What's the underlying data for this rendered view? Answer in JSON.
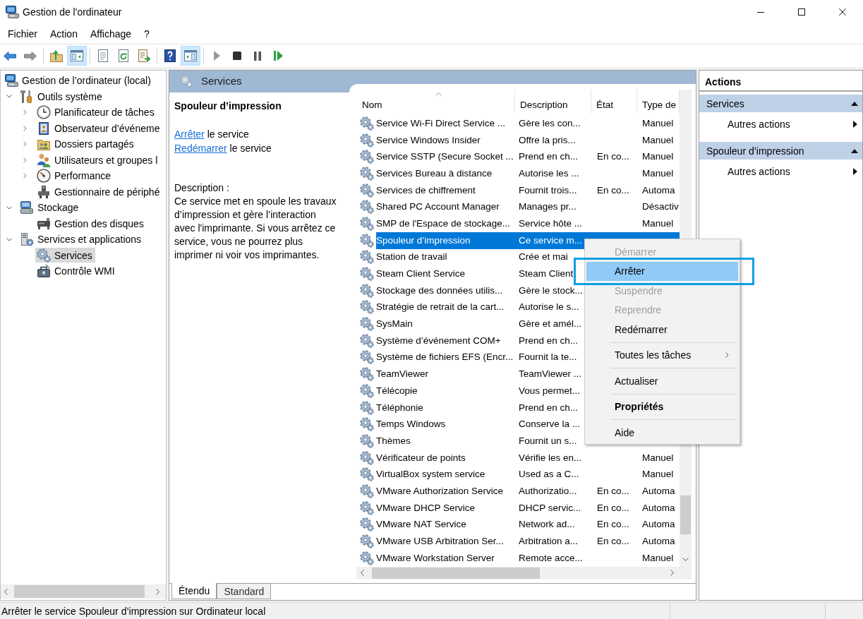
{
  "window": {
    "title": "Gestion de l'ordinateur"
  },
  "menu": [
    "Fichier",
    "Action",
    "Affichage",
    "?"
  ],
  "toolbar": [
    [
      {
        "disabled": false,
        "on": false
      },
      {
        "disabled": true,
        "on": false
      }
    ],
    [
      {
        "disabled": false,
        "on": false
      },
      {
        "disabled": false,
        "on": true
      }
    ],
    [
      {
        "disabled": false,
        "on": false
      },
      {
        "disabled": false,
        "on": false
      },
      {
        "disabled": false,
        "on": false
      }
    ],
    [
      {
        "disabled": false,
        "on": false
      },
      {
        "disabled": false,
        "on": true
      }
    ],
    [
      {
        "disabled": true,
        "on": false
      },
      {
        "disabled": false,
        "on": false
      },
      {
        "disabled": false,
        "on": false
      },
      {
        "disabled": false,
        "on": false
      }
    ]
  ],
  "tree": [
    {
      "label": "Gestion de l’ordinateur (local)",
      "selected": false,
      "children": [
        {
          "label": "Outils système",
          "expanded": true,
          "selected": false,
          "children": [
            {
              "label": "Planificateur de tâches",
              "expanded": false,
              "selected": false
            },
            {
              "label": "Observateur d’événeme",
              "expanded": false,
              "selected": false
            },
            {
              "label": "Dossiers partagés",
              "expanded": false,
              "selected": false
            },
            {
              "label": "Utilisateurs et groupes l",
              "expanded": false,
              "selected": false
            },
            {
              "label": "Performance",
              "expanded": false,
              "selected": false
            },
            {
              "label": "Gestionnaire de périphé",
              "selected": false
            }
          ]
        },
        {
          "label": "Stockage",
          "expanded": true,
          "selected": false,
          "children": [
            {
              "label": "Gestion des disques",
              "selected": false
            }
          ]
        },
        {
          "label": "Services et applications",
          "expanded": true,
          "selected": false,
          "children": [
            {
              "label": "Services",
              "selected": true
            },
            {
              "label": "Contrôle WMI",
              "selected": false
            }
          ]
        }
      ]
    }
  ],
  "console": {
    "title": "Services",
    "detail": {
      "heading": "Spouleur d’impression",
      "links": [
        {
          "link": "Arrêter",
          "text": "le service"
        },
        {
          "link": "Redémarrer",
          "text": "le service"
        }
      ],
      "description_label": "Description :",
      "description": "Ce service met en spoule les travaux d’impression et gère l’interaction avec l'imprimante. Si vous arrêtez ce service, vous ne pourrez plus imprimer ni voir vos imprimantes."
    },
    "table": {
      "columns": [
        {
          "label": "Nom",
          "sorted": true
        },
        {
          "label": "Description",
          "sorted": false
        },
        {
          "label": "État",
          "sorted": false
        },
        {
          "label": "Type de",
          "sorted": false
        }
      ],
      "rows": [
        {
          "name": "Service Wi-Fi Direct Service ...",
          "description": "Gère les con...",
          "startup_type": "Manuel",
          "selected": false
        },
        {
          "name": "Service Windows Insider",
          "description": "Offre la pris...",
          "startup_type": "Manuel",
          "selected": false
        },
        {
          "name": "Service SSTP (Secure Socket ...",
          "description": "Prend en ch...",
          "status": "En co...",
          "startup_type": "Manuel",
          "selected": false
        },
        {
          "name": "Services Bureau à distance",
          "description": "Autorise les ...",
          "startup_type": "Manuel",
          "selected": false
        },
        {
          "name": "Services de chiffrement",
          "description": "Fournit trois...",
          "status": "En co...",
          "startup_type": "Automa",
          "selected": false
        },
        {
          "name": "Shared PC Account Manager",
          "description": "Manages pr...",
          "startup_type": "Désactiv",
          "selected": false
        },
        {
          "name": "SMP de l'Espace de stockage...",
          "description": "Service hôte ...",
          "startup_type": "Manuel",
          "selected": false
        },
        {
          "name": "Spouleur d’impression",
          "description": "Ce service m...",
          "selected": true
        },
        {
          "name": "Station de travail",
          "description": "Crée et mai",
          "selected": false
        },
        {
          "name": "Steam Client Service",
          "description": "Steam Client",
          "selected": false
        },
        {
          "name": "Stockage des données utilis...",
          "description": "Gère le stock...",
          "selected": false
        },
        {
          "name": "Stratégie de retrait de la cart...",
          "description": "Autorise le s...",
          "selected": false
        },
        {
          "name": "SysMain",
          "description": "Gère et amél...",
          "selected": false
        },
        {
          "name": "Système d’événement COM+",
          "description": "Prend en ch...",
          "selected": false
        },
        {
          "name": "Système de fichiers EFS (Encr...",
          "description": "Fournit la te...",
          "selected": false
        },
        {
          "name": "TeamViewer",
          "description": "TeamViewer ...",
          "selected": false
        },
        {
          "name": "Télécopie",
          "description": "Vous permet...",
          "selected": false
        },
        {
          "name": "Téléphonie",
          "description": "Prend en ch...",
          "selected": false
        },
        {
          "name": "Temps Windows",
          "description": "Conserve la ...",
          "selected": false
        },
        {
          "name": "Thèmes",
          "description": "Fournit un s...",
          "selected": false
        },
        {
          "name": "Vérificateur de points",
          "description": "Vérifie les en...",
          "startup_type": "Manuel",
          "selected": false
        },
        {
          "name": "VirtualBox system service",
          "description": "Used as a C...",
          "startup_type": "Manuel",
          "selected": false
        },
        {
          "name": "VMware Authorization Service",
          "description": "Authorizatio...",
          "status": "En co...",
          "startup_type": "Automa",
          "selected": false
        },
        {
          "name": "VMware DHCP Service",
          "description": "DHCP servic...",
          "status": "En co...",
          "startup_type": "Automa",
          "selected": false
        },
        {
          "name": "VMware NAT Service",
          "description": "Network ad...",
          "status": "En co...",
          "startup_type": "Automa",
          "selected": false
        },
        {
          "name": "VMware USB Arbitration Ser...",
          "description": "Arbitration a...",
          "status": "En co...",
          "startup_type": "Automa",
          "selected": false
        },
        {
          "name": "VMware Workstation Server",
          "description": "Remote acce...",
          "startup_type": "Manuel",
          "selected": false
        }
      ]
    },
    "view_tabs": [
      {
        "label": "Étendu",
        "selected": true
      },
      {
        "label": "Standard",
        "selected": false
      }
    ]
  },
  "actions": {
    "title": "Actions",
    "sections": [
      {
        "title": "Services",
        "expanded": true,
        "items": [
          {
            "label": "Autres actions",
            "submenu": true
          }
        ]
      },
      {
        "title": "Spouleur d’impression",
        "expanded": true,
        "items": [
          {
            "label": "Autres actions",
            "submenu": true
          }
        ]
      }
    ]
  },
  "context_menu": {
    "groups": [
      [
        {
          "label": "Démarrer",
          "disabled": true,
          "selected": false,
          "default": false,
          "submenu": false,
          "annotated": false
        },
        {
          "label": "Arrêter",
          "disabled": false,
          "selected": true,
          "default": false,
          "submenu": false,
          "annotated": true
        },
        {
          "label": "Suspendre",
          "disabled": true,
          "selected": false,
          "default": false,
          "submenu": false,
          "annotated": false
        },
        {
          "label": "Reprendre",
          "disabled": true,
          "selected": false,
          "default": false,
          "submenu": false,
          "annotated": false
        },
        {
          "label": "Redémarrer",
          "disabled": false,
          "selected": false,
          "default": false,
          "submenu": false,
          "annotated": false
        }
      ],
      [
        {
          "label": "Toutes les tâches",
          "disabled": false,
          "selected": false,
          "default": false,
          "submenu": true,
          "annotated": false
        }
      ],
      [
        {
          "label": "Actualiser",
          "disabled": false,
          "selected": false,
          "default": false,
          "submenu": false,
          "annotated": false
        }
      ],
      [
        {
          "label": "Propriétés",
          "disabled": false,
          "selected": false,
          "default": true,
          "submenu": false,
          "annotated": false
        }
      ],
      [
        {
          "label": "Aide",
          "disabled": false,
          "selected": false,
          "default": false,
          "submenu": false,
          "annotated": false
        }
      ]
    ]
  },
  "status_bar": {
    "text": "Arrêter le service Spouleur d’impression sur Ordinateur local"
  }
}
